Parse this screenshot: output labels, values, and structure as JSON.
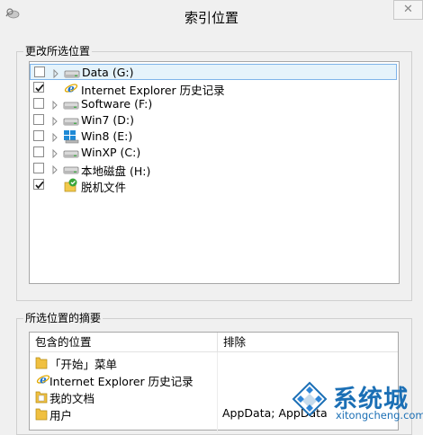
{
  "window": {
    "title": "索引位置",
    "close_glyph": "✕"
  },
  "change_locations": {
    "caption": "更改所选位置",
    "items": [
      {
        "label": "Data (G:)",
        "checked": false,
        "expandable": true,
        "icon": "drive-icon",
        "selected": true
      },
      {
        "label": "Internet Explorer 历史记录",
        "checked": true,
        "expandable": false,
        "icon": "internet-explorer-icon",
        "selected": false
      },
      {
        "label": "Software (F:)",
        "checked": false,
        "expandable": true,
        "icon": "drive-icon",
        "selected": false
      },
      {
        "label": "Win7 (D:)",
        "checked": false,
        "expandable": true,
        "icon": "drive-icon",
        "selected": false
      },
      {
        "label": "Win8 (E:)",
        "checked": false,
        "expandable": true,
        "icon": "windows-drive-icon",
        "selected": false
      },
      {
        "label": "WinXP (C:)",
        "checked": false,
        "expandable": true,
        "icon": "drive-icon",
        "selected": false
      },
      {
        "label": "本地磁盘 (H:)",
        "checked": false,
        "expandable": true,
        "icon": "drive-icon",
        "selected": false
      },
      {
        "label": "脱机文件",
        "checked": true,
        "expandable": false,
        "icon": "offline-files-icon",
        "selected": false
      }
    ]
  },
  "summary": {
    "caption": "所选位置的摘要",
    "columns": [
      "包含的位置",
      "排除"
    ],
    "rows": [
      {
        "location": "「开始」菜单",
        "exclude": "",
        "icon": "folder-icon"
      },
      {
        "location": "Internet Explorer 历史记录",
        "exclude": "",
        "icon": "internet-explorer-icon"
      },
      {
        "location": "我的文档",
        "exclude": "",
        "icon": "documents-folder-icon"
      },
      {
        "location": "用户",
        "exclude": "AppData; AppData",
        "icon": "folder-icon"
      }
    ]
  },
  "watermark": {
    "brand": "系统城",
    "url": "xitongcheng.com"
  },
  "colors": {
    "selection_bg": "#e5f3fb",
    "selection_border": "#7eb4ea",
    "watermark_blue": "#1b6fb5"
  }
}
